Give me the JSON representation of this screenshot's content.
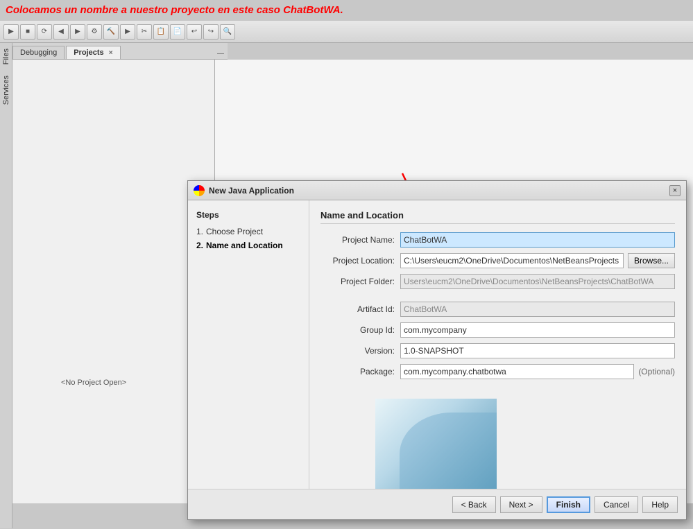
{
  "annotation": {
    "text": "Colocamos un nombre a nuestro proyecto en este caso ChatBotWA."
  },
  "ide": {
    "tabs": [
      {
        "label": "Debugging",
        "active": false,
        "closeable": false
      },
      {
        "label": "Projects",
        "active": true,
        "closeable": true
      }
    ],
    "sidebar_labels": [
      "Files",
      "Services"
    ],
    "no_project": "<No Project Open>"
  },
  "dialog": {
    "title": "New Java Application",
    "close_btn": "×",
    "steps_title": "Steps",
    "steps": [
      {
        "num": "1.",
        "label": "Choose Project",
        "active": false
      },
      {
        "num": "2.",
        "label": "Name and Location",
        "active": true
      }
    ],
    "form": {
      "section_title": "Name and Location",
      "fields": [
        {
          "label": "Project Name:",
          "value": "ChatBotWA",
          "placeholder": "",
          "disabled": false,
          "highlighted": true,
          "has_browse": false
        },
        {
          "label": "Project Location:",
          "value": "C:\\Users\\eucm2\\OneDrive\\Documentos\\NetBeansProjects",
          "placeholder": "",
          "disabled": false,
          "highlighted": false,
          "has_browse": true,
          "browse_label": "Browse..."
        },
        {
          "label": "Project Folder:",
          "value": "Users\\eucm2\\OneDrive\\Documentos\\NetBeansProjects\\ChatBotWA",
          "placeholder": "",
          "disabled": true,
          "highlighted": false,
          "has_browse": false
        },
        {
          "label": "Artifact Id:",
          "value": "ChatBotWA",
          "placeholder": "",
          "disabled": true,
          "highlighted": false,
          "has_browse": false
        },
        {
          "label": "Group Id:",
          "value": "com.mycompany",
          "placeholder": "",
          "disabled": false,
          "highlighted": false,
          "has_browse": false
        },
        {
          "label": "Version:",
          "value": "1.0-SNAPSHOT",
          "placeholder": "",
          "disabled": false,
          "highlighted": false,
          "has_browse": false
        },
        {
          "label": "Package:",
          "value": "com.mycompany.chatbotwa",
          "placeholder": "",
          "disabled": false,
          "highlighted": false,
          "has_browse": false,
          "optional": true
        }
      ]
    },
    "footer": {
      "back_label": "< Back",
      "next_label": "Next >",
      "finish_label": "Finish",
      "cancel_label": "Cancel",
      "help_label": "Help"
    }
  }
}
